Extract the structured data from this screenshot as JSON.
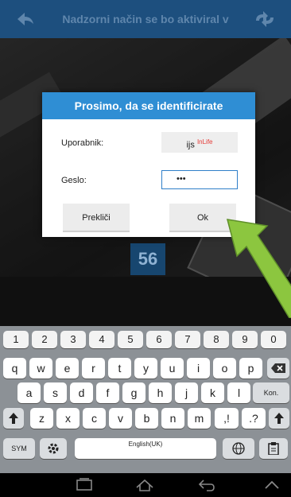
{
  "header": {
    "title": "Nadzorni način se bo aktiviral v"
  },
  "camera": {
    "counter": "56"
  },
  "dialog": {
    "title": "Prosimo, da se identificirate",
    "user_label": "Uporabnik:",
    "user_value": "ijs",
    "user_badge": "InLife",
    "password_label": "Geslo:",
    "password_value": "•••",
    "cancel_label": "Prekliči",
    "ok_label": "Ok"
  },
  "keyboard": {
    "numbers": [
      "1",
      "2",
      "3",
      "4",
      "5",
      "6",
      "7",
      "8",
      "9",
      "0"
    ],
    "row1": [
      "q",
      "w",
      "e",
      "r",
      "t",
      "y",
      "u",
      "i",
      "o",
      "p"
    ],
    "row2": [
      "a",
      "s",
      "d",
      "f",
      "g",
      "h",
      "j",
      "k",
      "l"
    ],
    "row3": [
      "z",
      "x",
      "c",
      "v",
      "b",
      "n",
      "m"
    ],
    "enter_label": "Kon.",
    "punct1": ",!",
    "punct2": ".?",
    "sym_label": "SYM",
    "space_label": "English(UK)"
  },
  "colors": {
    "header_bg": "#1d4f7e",
    "dialog_title_bg": "#2f8ed4",
    "arrow": "#8cc63f"
  }
}
